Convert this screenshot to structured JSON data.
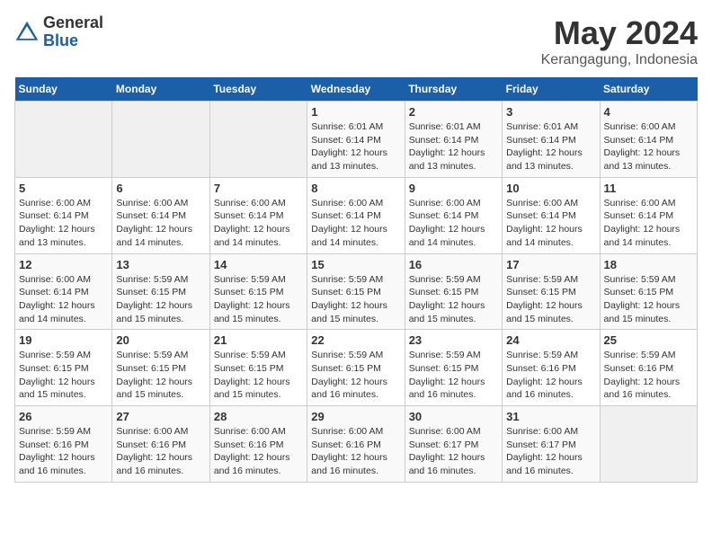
{
  "header": {
    "logo_general": "General",
    "logo_blue": "Blue",
    "title": "May 2024",
    "subtitle": "Kerangagung, Indonesia"
  },
  "calendar": {
    "days_of_week": [
      "Sunday",
      "Monday",
      "Tuesday",
      "Wednesday",
      "Thursday",
      "Friday",
      "Saturday"
    ],
    "weeks": [
      [
        {
          "date": "",
          "info": ""
        },
        {
          "date": "",
          "info": ""
        },
        {
          "date": "",
          "info": ""
        },
        {
          "date": "1",
          "info": "Sunrise: 6:01 AM\nSunset: 6:14 PM\nDaylight: 12 hours\nand 13 minutes."
        },
        {
          "date": "2",
          "info": "Sunrise: 6:01 AM\nSunset: 6:14 PM\nDaylight: 12 hours\nand 13 minutes."
        },
        {
          "date": "3",
          "info": "Sunrise: 6:01 AM\nSunset: 6:14 PM\nDaylight: 12 hours\nand 13 minutes."
        },
        {
          "date": "4",
          "info": "Sunrise: 6:00 AM\nSunset: 6:14 PM\nDaylight: 12 hours\nand 13 minutes."
        }
      ],
      [
        {
          "date": "5",
          "info": "Sunrise: 6:00 AM\nSunset: 6:14 PM\nDaylight: 12 hours\nand 13 minutes."
        },
        {
          "date": "6",
          "info": "Sunrise: 6:00 AM\nSunset: 6:14 PM\nDaylight: 12 hours\nand 14 minutes."
        },
        {
          "date": "7",
          "info": "Sunrise: 6:00 AM\nSunset: 6:14 PM\nDaylight: 12 hours\nand 14 minutes."
        },
        {
          "date": "8",
          "info": "Sunrise: 6:00 AM\nSunset: 6:14 PM\nDaylight: 12 hours\nand 14 minutes."
        },
        {
          "date": "9",
          "info": "Sunrise: 6:00 AM\nSunset: 6:14 PM\nDaylight: 12 hours\nand 14 minutes."
        },
        {
          "date": "10",
          "info": "Sunrise: 6:00 AM\nSunset: 6:14 PM\nDaylight: 12 hours\nand 14 minutes."
        },
        {
          "date": "11",
          "info": "Sunrise: 6:00 AM\nSunset: 6:14 PM\nDaylight: 12 hours\nand 14 minutes."
        }
      ],
      [
        {
          "date": "12",
          "info": "Sunrise: 6:00 AM\nSunset: 6:14 PM\nDaylight: 12 hours\nand 14 minutes."
        },
        {
          "date": "13",
          "info": "Sunrise: 5:59 AM\nSunset: 6:15 PM\nDaylight: 12 hours\nand 15 minutes."
        },
        {
          "date": "14",
          "info": "Sunrise: 5:59 AM\nSunset: 6:15 PM\nDaylight: 12 hours\nand 15 minutes."
        },
        {
          "date": "15",
          "info": "Sunrise: 5:59 AM\nSunset: 6:15 PM\nDaylight: 12 hours\nand 15 minutes."
        },
        {
          "date": "16",
          "info": "Sunrise: 5:59 AM\nSunset: 6:15 PM\nDaylight: 12 hours\nand 15 minutes."
        },
        {
          "date": "17",
          "info": "Sunrise: 5:59 AM\nSunset: 6:15 PM\nDaylight: 12 hours\nand 15 minutes."
        },
        {
          "date": "18",
          "info": "Sunrise: 5:59 AM\nSunset: 6:15 PM\nDaylight: 12 hours\nand 15 minutes."
        }
      ],
      [
        {
          "date": "19",
          "info": "Sunrise: 5:59 AM\nSunset: 6:15 PM\nDaylight: 12 hours\nand 15 minutes."
        },
        {
          "date": "20",
          "info": "Sunrise: 5:59 AM\nSunset: 6:15 PM\nDaylight: 12 hours\nand 15 minutes."
        },
        {
          "date": "21",
          "info": "Sunrise: 5:59 AM\nSunset: 6:15 PM\nDaylight: 12 hours\nand 15 minutes."
        },
        {
          "date": "22",
          "info": "Sunrise: 5:59 AM\nSunset: 6:15 PM\nDaylight: 12 hours\nand 16 minutes."
        },
        {
          "date": "23",
          "info": "Sunrise: 5:59 AM\nSunset: 6:15 PM\nDaylight: 12 hours\nand 16 minutes."
        },
        {
          "date": "24",
          "info": "Sunrise: 5:59 AM\nSunset: 6:16 PM\nDaylight: 12 hours\nand 16 minutes."
        },
        {
          "date": "25",
          "info": "Sunrise: 5:59 AM\nSunset: 6:16 PM\nDaylight: 12 hours\nand 16 minutes."
        }
      ],
      [
        {
          "date": "26",
          "info": "Sunrise: 5:59 AM\nSunset: 6:16 PM\nDaylight: 12 hours\nand 16 minutes."
        },
        {
          "date": "27",
          "info": "Sunrise: 6:00 AM\nSunset: 6:16 PM\nDaylight: 12 hours\nand 16 minutes."
        },
        {
          "date": "28",
          "info": "Sunrise: 6:00 AM\nSunset: 6:16 PM\nDaylight: 12 hours\nand 16 minutes."
        },
        {
          "date": "29",
          "info": "Sunrise: 6:00 AM\nSunset: 6:16 PM\nDaylight: 12 hours\nand 16 minutes."
        },
        {
          "date": "30",
          "info": "Sunrise: 6:00 AM\nSunset: 6:17 PM\nDaylight: 12 hours\nand 16 minutes."
        },
        {
          "date": "31",
          "info": "Sunrise: 6:00 AM\nSunset: 6:17 PM\nDaylight: 12 hours\nand 16 minutes."
        },
        {
          "date": "",
          "info": ""
        }
      ]
    ]
  }
}
